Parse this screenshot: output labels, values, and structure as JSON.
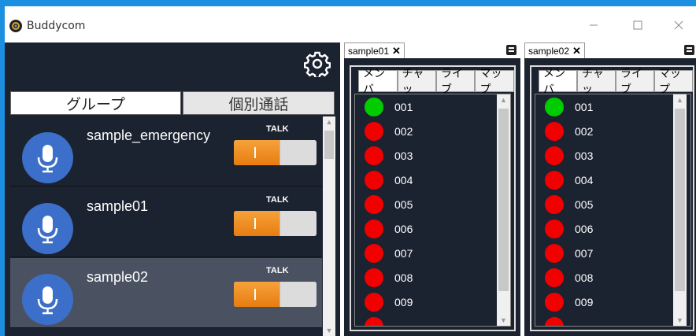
{
  "window": {
    "title": "Buddycom"
  },
  "groups_panel": {
    "tabs": [
      "グループ",
      "個別通話"
    ],
    "groups": [
      {
        "name": "sample_emergency",
        "talk_label": "TALK",
        "talk_on": true,
        "selected": false
      },
      {
        "name": "sample01",
        "talk_label": "TALK",
        "talk_on": true,
        "selected": false
      },
      {
        "name": "sample02",
        "talk_label": "TALK",
        "talk_on": true,
        "selected": true
      }
    ]
  },
  "member_panels": [
    {
      "tab_title": "sample01",
      "subtabs": [
        "メンバ",
        "チャッ",
        "ライブ",
        "マップ"
      ],
      "members": [
        {
          "id": "001",
          "status": "online"
        },
        {
          "id": "002",
          "status": "offline"
        },
        {
          "id": "003",
          "status": "offline"
        },
        {
          "id": "004",
          "status": "offline"
        },
        {
          "id": "005",
          "status": "offline"
        },
        {
          "id": "006",
          "status": "offline"
        },
        {
          "id": "007",
          "status": "offline"
        },
        {
          "id": "008",
          "status": "offline"
        },
        {
          "id": "009",
          "status": "offline"
        }
      ]
    },
    {
      "tab_title": "sample02",
      "subtabs": [
        "メンバ",
        "チャッ",
        "ライブ",
        "マップ"
      ],
      "members": [
        {
          "id": "001",
          "status": "online"
        },
        {
          "id": "002",
          "status": "offline"
        },
        {
          "id": "003",
          "status": "offline"
        },
        {
          "id": "004",
          "status": "offline"
        },
        {
          "id": "005",
          "status": "offline"
        },
        {
          "id": "006",
          "status": "offline"
        },
        {
          "id": "007",
          "status": "offline"
        },
        {
          "id": "008",
          "status": "offline"
        },
        {
          "id": "009",
          "status": "offline"
        }
      ]
    }
  ],
  "colors": {
    "accent": "#1c8fe0",
    "panel_bg": "#1b2230",
    "online": "#00cc00",
    "offline": "#f20000",
    "toggle_on": "#ee8a20",
    "mic_bg": "#3c6fc9"
  },
  "icons": {
    "app": "buddycom-logo-icon",
    "settings": "gear-icon",
    "group": "microphone-icon",
    "tab_close": "close-icon",
    "panel_menu": "menu-icon"
  }
}
